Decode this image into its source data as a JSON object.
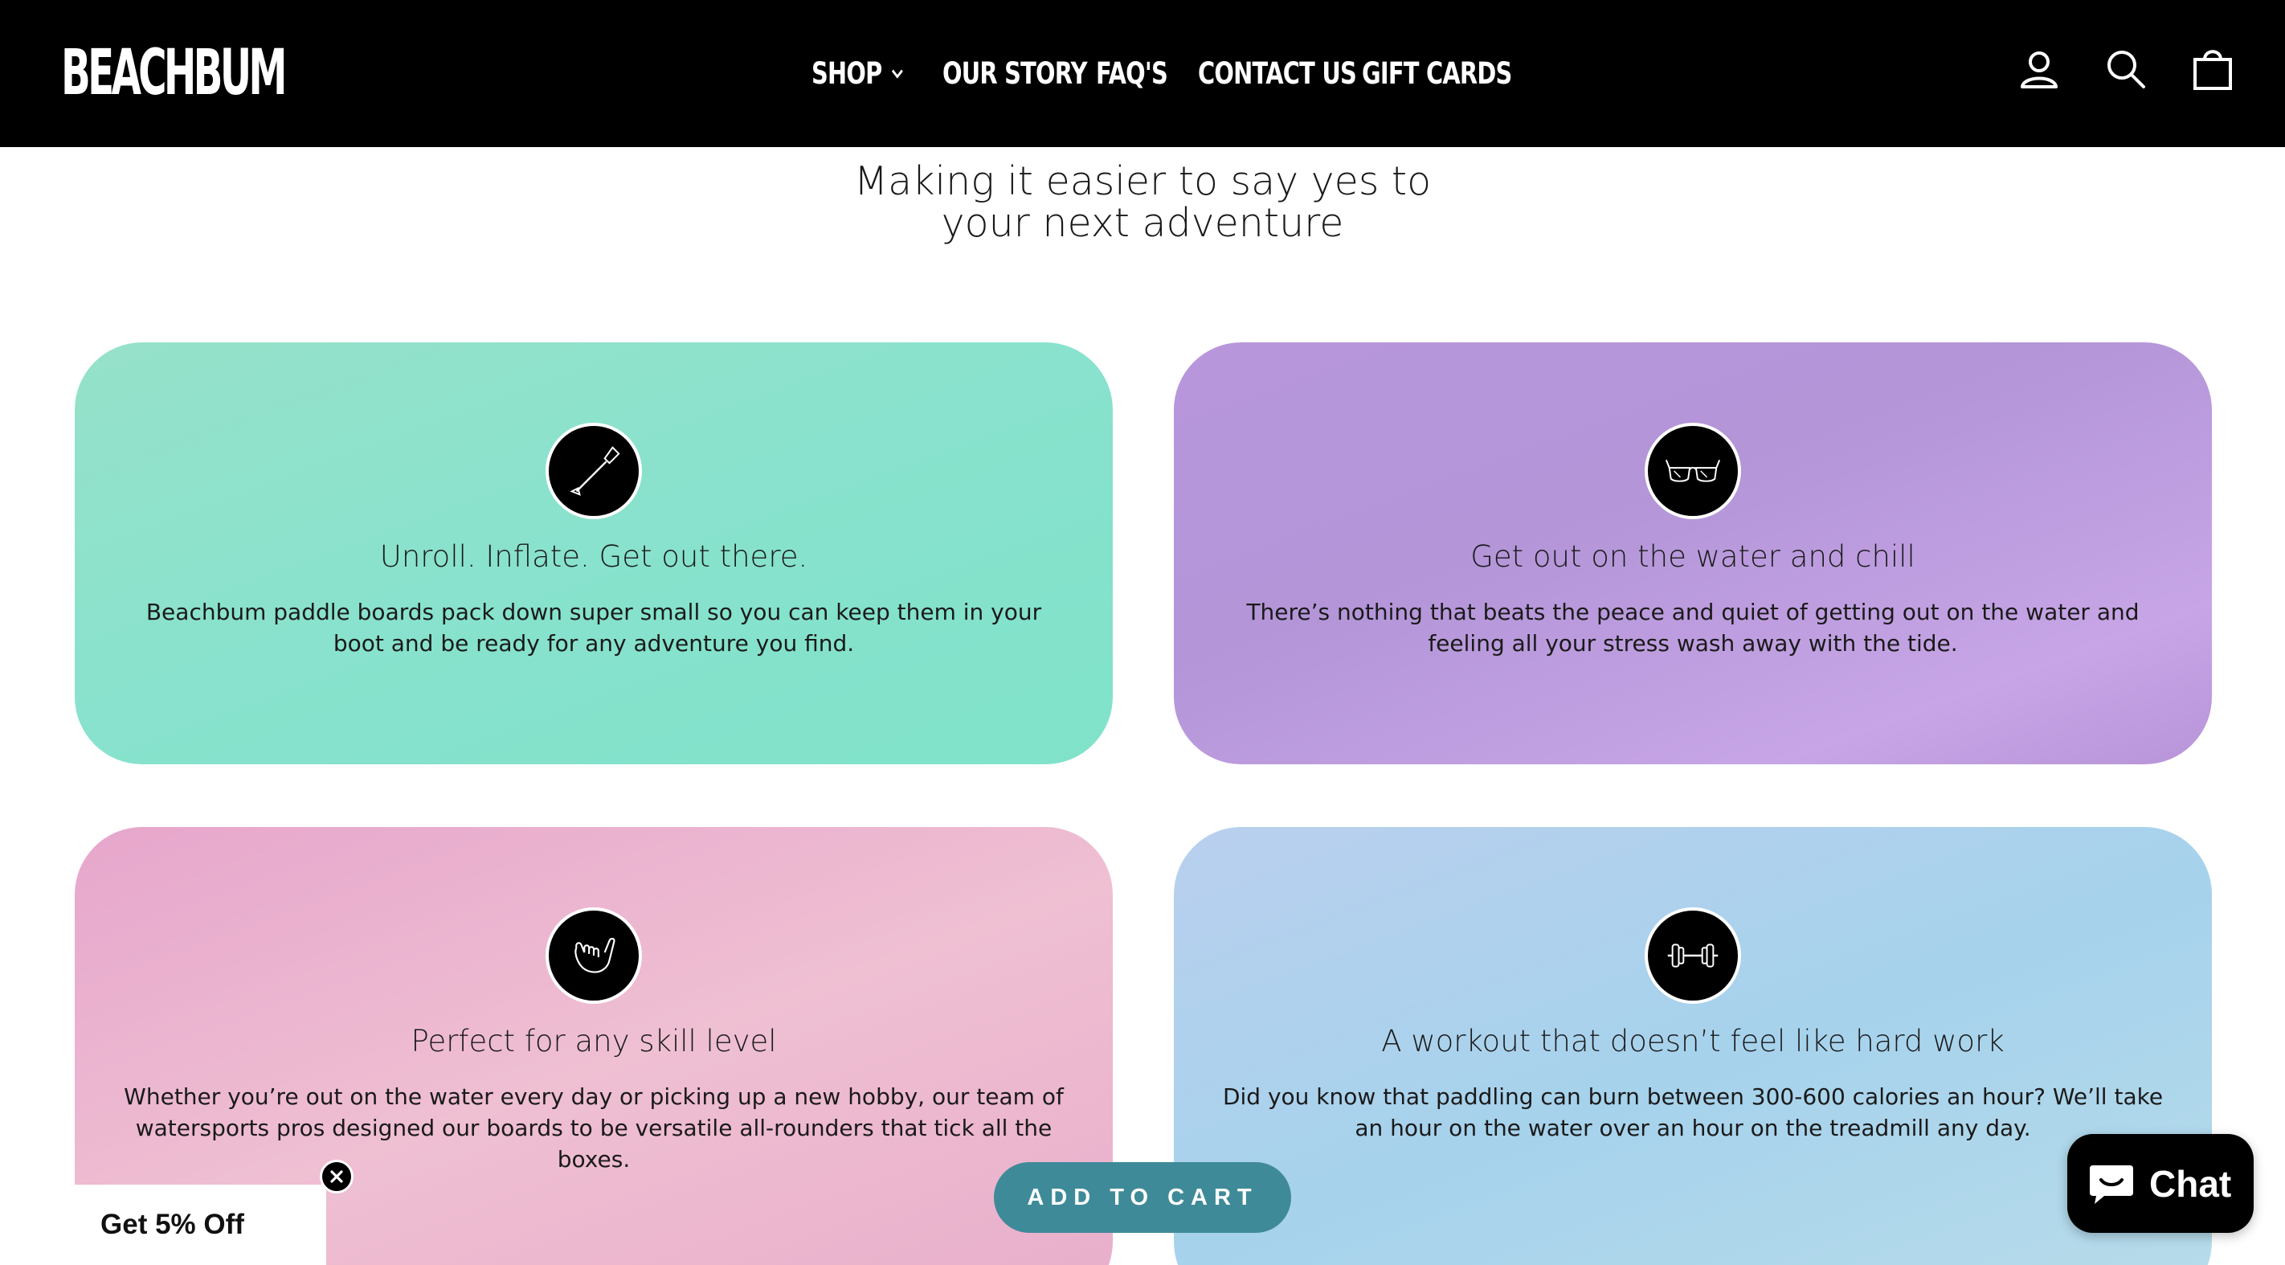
{
  "header": {
    "logo": "BEACHBUM",
    "nav": [
      {
        "label": "SHOP",
        "has_dropdown": true
      },
      {
        "label": "OUR STORY"
      },
      {
        "label": "FAQ'S"
      },
      {
        "label": "CONTACT US"
      },
      {
        "label": "GIFT CARDS"
      }
    ],
    "icons": [
      "account-icon",
      "search-icon",
      "cart-icon"
    ]
  },
  "section": {
    "headline_line1": "Making it easier to say yes to",
    "headline_line2": "your next adventure"
  },
  "features": [
    {
      "icon": "paddle-icon",
      "title": "Unroll. Inflate. Get out there.",
      "text": "Beachbum paddle boards pack down super small so you can keep them in your boot and be ready for any adventure you find.",
      "color": "#8fe2cb"
    },
    {
      "icon": "sunglasses-icon",
      "title": "Get out on the water and chill",
      "text": "There’s nothing that beats the peace and quiet of getting out on the water and feeling all your stress wash away with the tide.",
      "color": "#b898dc"
    },
    {
      "icon": "shaka-hand-icon",
      "title": "Perfect for any skill level",
      "text": "Whether you’re out on the water every day or picking up a new hobby, our team of watersports pros designed our boards to be versatile all-rounders that tick all the boxes.",
      "color": "#ebb4cd"
    },
    {
      "icon": "dumbbell-icon",
      "title": "A workout that doesn’t feel like hard work",
      "text": "Did you know that paddling can burn between 300-600 calories an hour? We’ll take an hour on the water over an hour on the treadmill any day.",
      "color": "#add3ec"
    }
  ],
  "promo": {
    "label": "Get 5% Off"
  },
  "add_to_cart": {
    "label": "ADD TO CART",
    "color": "#3f8a98"
  },
  "chat": {
    "label": "Chat"
  }
}
